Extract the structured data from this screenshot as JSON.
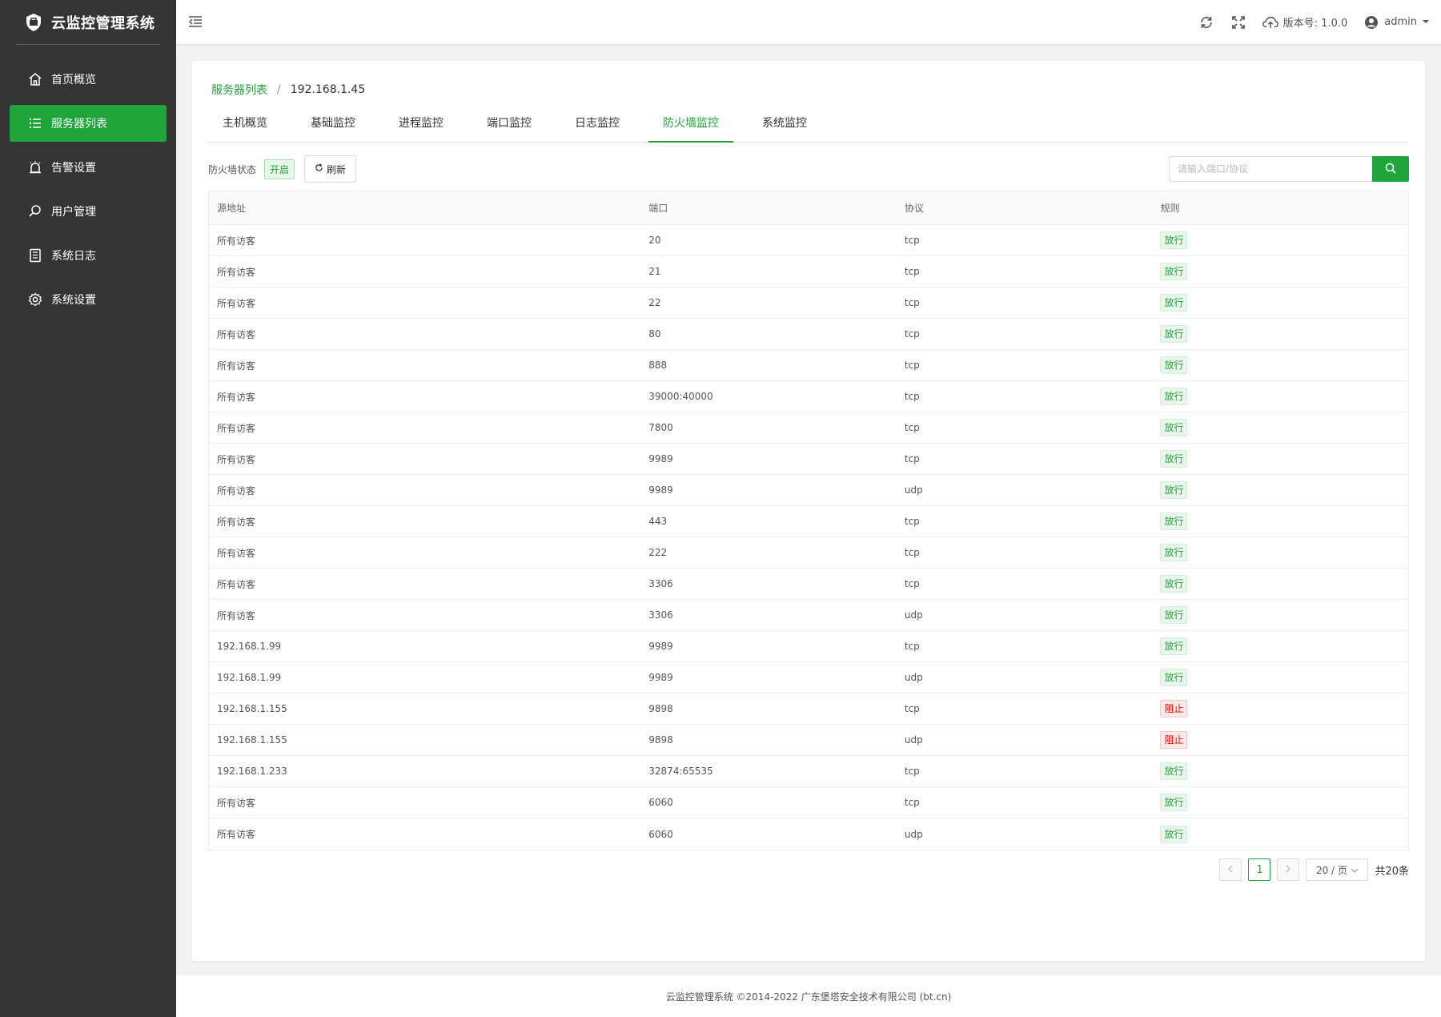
{
  "app": {
    "title": "云监控管理系统",
    "logo_icon": "shield-logo-icon"
  },
  "sidebar": {
    "items": [
      {
        "label": "首页概览",
        "icon": "home-icon",
        "active": false
      },
      {
        "label": "服务器列表",
        "icon": "list-icon",
        "active": true
      },
      {
        "label": "告警设置",
        "icon": "alarm-icon",
        "active": false
      },
      {
        "label": "用户管理",
        "icon": "search-user-icon",
        "active": false
      },
      {
        "label": "系统日志",
        "icon": "log-icon",
        "active": false
      },
      {
        "label": "系统设置",
        "icon": "gear-icon",
        "active": false
      }
    ]
  },
  "header": {
    "version_label": "版本号: 1.0.0",
    "user_name": "admin",
    "icons": [
      "refresh-icon",
      "fullscreen-icon",
      "cloud-upload-icon",
      "user-circle-icon"
    ]
  },
  "breadcrumb": {
    "parent": "服务器列表",
    "separator": "/",
    "current": "192.168.1.45"
  },
  "tabs": [
    {
      "label": "主机概览",
      "active": false
    },
    {
      "label": "基础监控",
      "active": false
    },
    {
      "label": "进程监控",
      "active": false
    },
    {
      "label": "端口监控",
      "active": false
    },
    {
      "label": "日志监控",
      "active": false
    },
    {
      "label": "防火墙监控",
      "active": true
    },
    {
      "label": "系统监控",
      "active": false
    }
  ],
  "toolbar": {
    "status_label": "防火墙状态",
    "status_value": "开启",
    "refresh_label": "刷新",
    "search_placeholder": "请输入端口/协议"
  },
  "table": {
    "headers": [
      "源地址",
      "端口",
      "协议",
      "规则"
    ],
    "rows": [
      {
        "source": "所有访客",
        "port": "20",
        "protocol": "tcp",
        "rule": "放行",
        "rule_type": "allow"
      },
      {
        "source": "所有访客",
        "port": "21",
        "protocol": "tcp",
        "rule": "放行",
        "rule_type": "allow"
      },
      {
        "source": "所有访客",
        "port": "22",
        "protocol": "tcp",
        "rule": "放行",
        "rule_type": "allow"
      },
      {
        "source": "所有访客",
        "port": "80",
        "protocol": "tcp",
        "rule": "放行",
        "rule_type": "allow"
      },
      {
        "source": "所有访客",
        "port": "888",
        "protocol": "tcp",
        "rule": "放行",
        "rule_type": "allow"
      },
      {
        "source": "所有访客",
        "port": "39000:40000",
        "protocol": "tcp",
        "rule": "放行",
        "rule_type": "allow"
      },
      {
        "source": "所有访客",
        "port": "7800",
        "protocol": "tcp",
        "rule": "放行",
        "rule_type": "allow"
      },
      {
        "source": "所有访客",
        "port": "9989",
        "protocol": "tcp",
        "rule": "放行",
        "rule_type": "allow"
      },
      {
        "source": "所有访客",
        "port": "9989",
        "protocol": "udp",
        "rule": "放行",
        "rule_type": "allow"
      },
      {
        "source": "所有访客",
        "port": "443",
        "protocol": "tcp",
        "rule": "放行",
        "rule_type": "allow"
      },
      {
        "source": "所有访客",
        "port": "222",
        "protocol": "tcp",
        "rule": "放行",
        "rule_type": "allow"
      },
      {
        "source": "所有访客",
        "port": "3306",
        "protocol": "tcp",
        "rule": "放行",
        "rule_type": "allow"
      },
      {
        "source": "所有访客",
        "port": "3306",
        "protocol": "udp",
        "rule": "放行",
        "rule_type": "allow"
      },
      {
        "source": "192.168.1.99",
        "port": "9989",
        "protocol": "tcp",
        "rule": "放行",
        "rule_type": "allow"
      },
      {
        "source": "192.168.1.99",
        "port": "9989",
        "protocol": "udp",
        "rule": "放行",
        "rule_type": "allow"
      },
      {
        "source": "192.168.1.155",
        "port": "9898",
        "protocol": "tcp",
        "rule": "阻止",
        "rule_type": "deny"
      },
      {
        "source": "192.168.1.155",
        "port": "9898",
        "protocol": "udp",
        "rule": "阻止",
        "rule_type": "deny"
      },
      {
        "source": "192.168.1.233",
        "port": "32874:65535",
        "protocol": "tcp",
        "rule": "放行",
        "rule_type": "allow"
      },
      {
        "source": "所有访客",
        "port": "6060",
        "protocol": "tcp",
        "rule": "放行",
        "rule_type": "allow"
      },
      {
        "source": "所有访客",
        "port": "6060",
        "protocol": "udp",
        "rule": "放行",
        "rule_type": "allow"
      }
    ]
  },
  "pagination": {
    "current_page": "1",
    "page_size": "20 / 页",
    "total": "共20条"
  },
  "footer": {
    "text": "云监控管理系统 ©2014-2022 广东堡塔安全技术有限公司 (bt.cn)"
  },
  "colors": {
    "accent": "#20a53a",
    "sidebar_bg": "#353535",
    "deny": "#ef0808"
  }
}
